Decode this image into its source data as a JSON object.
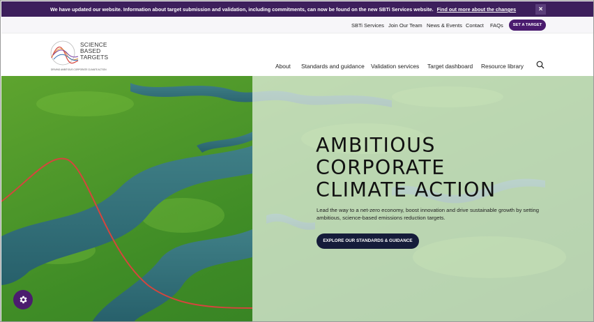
{
  "announcement": {
    "message": "We have updated our website. Information about target submission and validation, including commitments, can now be found on the new SBTi Services website.",
    "link_label": "Find out more about the changes",
    "close_label": "×"
  },
  "utility_nav": {
    "items": [
      {
        "label": "SBTi Services"
      },
      {
        "label": "Join Our Team"
      },
      {
        "label": "News & Events"
      },
      {
        "label": "Contact"
      },
      {
        "label": "FAQs"
      }
    ],
    "cta_label": "SET A TARGET"
  },
  "logo": {
    "line1": "SCIENCE",
    "line2": "BASED",
    "line3": "TARGETS",
    "tagline": "DRIVING AMBITIOUS CORPORATE CLIMATE ACTION"
  },
  "main_nav": {
    "items": [
      {
        "label": "About"
      },
      {
        "label": "Standards and guidance"
      },
      {
        "label": "Validation services"
      },
      {
        "label": "Target dashboard"
      },
      {
        "label": "Resource library"
      }
    ],
    "search_icon": "search-icon"
  },
  "hero": {
    "title_line1": "AMBITIOUS",
    "title_line2": "CORPORATE",
    "title_line3": "CLIMATE ACTION",
    "lead": "Lead the way to a net-zero economy, boost innovation and drive sustainable growth by setting ambitious, science-based emissions reduction targets.",
    "button_label": "EXPLORE OUR STANDARDS & GUIDANCE"
  },
  "cookie_settings_icon": "gear-icon",
  "colors": {
    "brand_purple": "#3d1f5c",
    "cta_purple": "#4a1b6e",
    "button_navy": "#151c3a",
    "curve_red": "#d6453d",
    "curve_blue": "#2f6fb5"
  }
}
